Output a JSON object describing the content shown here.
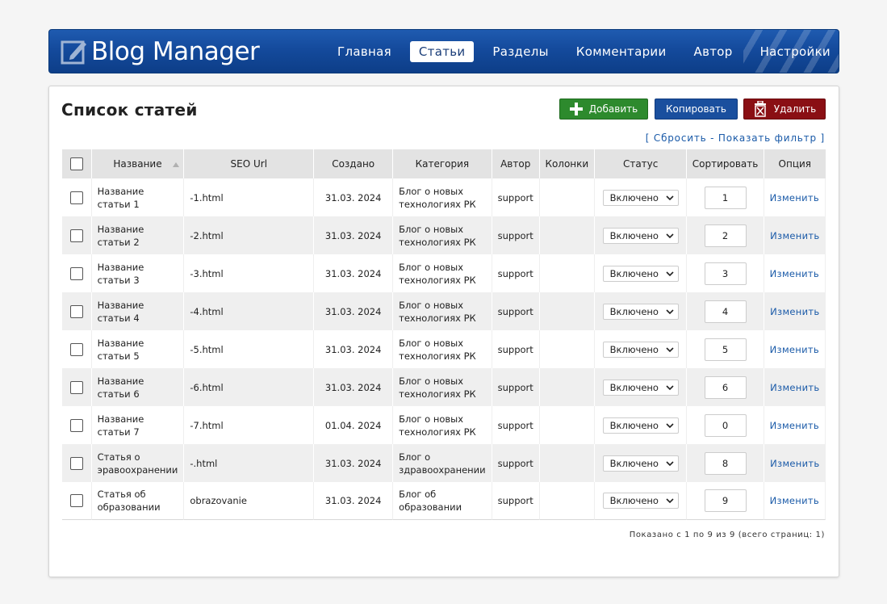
{
  "app": {
    "title": "Blog Manager"
  },
  "nav": {
    "items": [
      {
        "label": "Главная",
        "active": false
      },
      {
        "label": "Статьи",
        "active": true
      },
      {
        "label": "Разделы",
        "active": false
      },
      {
        "label": "Комментарии",
        "active": false
      },
      {
        "label": "Автор",
        "active": false
      },
      {
        "label": "Настройки",
        "active": false
      }
    ]
  },
  "page": {
    "title": "Список статей"
  },
  "toolbar": {
    "add_label": "Добавить",
    "copy_label": "Копировать",
    "delete_label": "Удалить"
  },
  "filter": {
    "open": "[",
    "reset": "Сбросить",
    "sep": "-",
    "show": "Показать фильтр",
    "close": "]"
  },
  "table": {
    "headers": {
      "name": "Название",
      "seo": "SEO Url",
      "created": "Создано",
      "category": "Категория",
      "author": "Автор",
      "columns": "Колонки",
      "status": "Статус",
      "sort": "Сортировать",
      "option": "Опция"
    },
    "rows": [
      {
        "name": "Название статьи 1",
        "seo": "-1.html",
        "created": "31.03. 2024",
        "category": "Блог о новых технологиях РК",
        "author": "support",
        "columns": "",
        "status": "Включено",
        "sort": "1",
        "option": "Изменить"
      },
      {
        "name": "Название статьи 2",
        "seo": "-2.html",
        "created": "31.03. 2024",
        "category": "Блог о новых технологиях РК",
        "author": "support",
        "columns": "",
        "status": "Включено",
        "sort": "2",
        "option": "Изменить"
      },
      {
        "name": "Название статьи 3",
        "seo": "-3.html",
        "created": "31.03. 2024",
        "category": "Блог о новых технологиях РК",
        "author": "support",
        "columns": "",
        "status": "Включено",
        "sort": "3",
        "option": "Изменить"
      },
      {
        "name": "Название статьи 4",
        "seo": "-4.html",
        "created": "31.03. 2024",
        "category": "Блог о новых технологиях РК",
        "author": "support",
        "columns": "",
        "status": "Включено",
        "sort": "4",
        "option": "Изменить"
      },
      {
        "name": "Название статьи 5",
        "seo": "-5.html",
        "created": "31.03. 2024",
        "category": "Блог о новых технологиях РК",
        "author": "support",
        "columns": "",
        "status": "Включено",
        "sort": "5",
        "option": "Изменить"
      },
      {
        "name": "Название статьи 6",
        "seo": "-6.html",
        "created": "31.03. 2024",
        "category": "Блог о новых технологиях РК",
        "author": "support",
        "columns": "",
        "status": "Включено",
        "sort": "6",
        "option": "Изменить"
      },
      {
        "name": "Название статьи 7",
        "seo": "-7.html",
        "created": "01.04. 2024",
        "category": "Блог о новых технологиях РК",
        "author": "support",
        "columns": "",
        "status": "Включено",
        "sort": "0",
        "option": "Изменить"
      },
      {
        "name": "Статья о эравоохранении",
        "seo": "-.html",
        "created": "31.03. 2024",
        "category": "Блог о здравоохранении",
        "author": "support",
        "columns": "",
        "status": "Включено",
        "sort": "8",
        "option": "Изменить"
      },
      {
        "name": "Статья об образовании",
        "seo": "obrazovanie",
        "created": "31.03. 2024",
        "category": "Блог об образовании",
        "author": "support",
        "columns": "",
        "status": "Включено",
        "sort": "9",
        "option": "Изменить"
      }
    ]
  },
  "pager": {
    "text": "Показано с 1 по 9 из 9 (всего страниц: 1)"
  },
  "colors": {
    "header_bg": "#144a9c",
    "add": "#2d8a2d",
    "copy": "#1a4f9e",
    "delete": "#8a0f14",
    "link": "#1a5aa8"
  },
  "icons": {
    "logo": "pencil-square-icon",
    "add": "plus-icon",
    "delete": "trash-icon",
    "sort": "sort-asc-icon",
    "select": "chevron-down-icon"
  }
}
